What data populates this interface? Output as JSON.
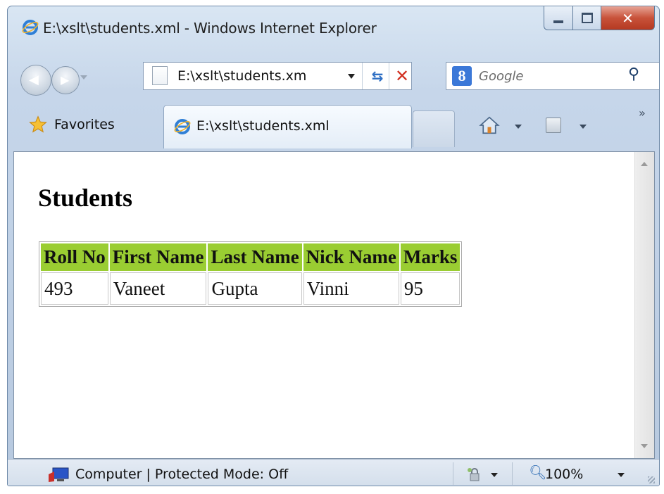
{
  "window": {
    "title": "E:\\xslt\\students.xml - Windows Internet Explorer"
  },
  "toolbar": {
    "address": "E:\\xslt\\students.xm",
    "search_placeholder": "Google",
    "refresh_icon": "refresh-icon",
    "stop_icon": "stop-icon"
  },
  "tabs": {
    "favorites_label": "Favorites",
    "active_tab_label": "E:\\xslt\\students.xml"
  },
  "page": {
    "heading": "Students",
    "table": {
      "headers": [
        "Roll No",
        "First Name",
        "Last Name",
        "Nick Name",
        "Marks"
      ],
      "rows": [
        [
          "493",
          "Vaneet",
          "Gupta",
          "Vinni",
          "95"
        ]
      ],
      "header_color": "#9acd32"
    }
  },
  "statusbar": {
    "zone_text": "Computer | Protected Mode: Off",
    "zoom": "100%"
  },
  "colors": {
    "chrome_blue": "#c6d6ea",
    "close_red": "#c8523a",
    "header_green": "#9acd32"
  }
}
